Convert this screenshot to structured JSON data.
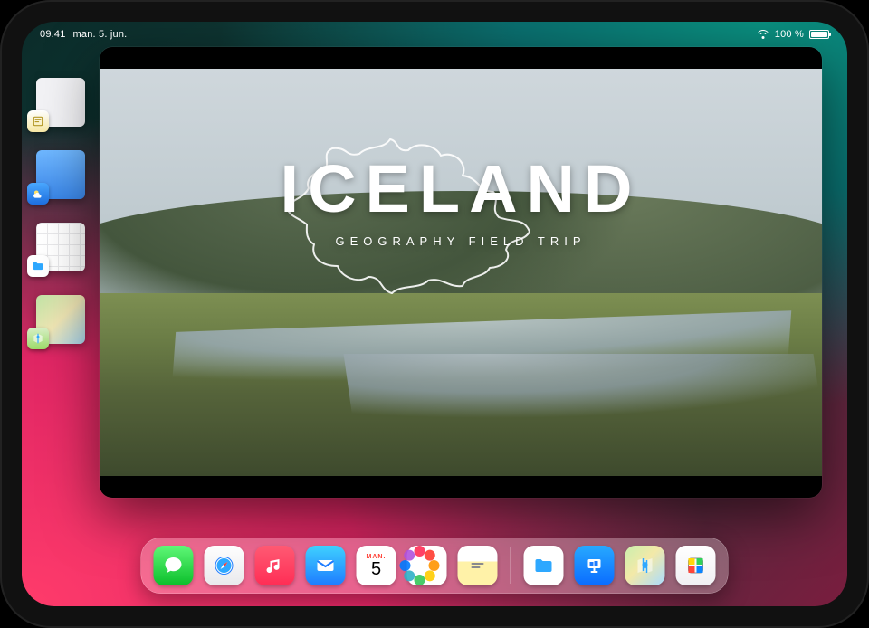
{
  "status": {
    "time": "09.41",
    "date": "man. 5. jun.",
    "battery_text": "100 %"
  },
  "stage_rail": {
    "items": [
      {
        "app": "notes",
        "name": "notes-window"
      },
      {
        "app": "weather",
        "name": "weather-window"
      },
      {
        "app": "files",
        "name": "files-window"
      },
      {
        "app": "maps",
        "name": "maps-window"
      }
    ]
  },
  "main_window": {
    "app": "keynote",
    "slide": {
      "title": "ICELAND",
      "subtitle": "GEOGRAPHY FIELD TRIP"
    }
  },
  "dock": {
    "primary": [
      {
        "app": "messages",
        "label": "Messages"
      },
      {
        "app": "safari",
        "label": "Safari"
      },
      {
        "app": "music",
        "label": "Music"
      },
      {
        "app": "mail",
        "label": "Mail"
      },
      {
        "app": "calendar",
        "label": "Calendar",
        "dow": "MAN.",
        "day": "5"
      },
      {
        "app": "photos",
        "label": "Photos"
      },
      {
        "app": "notes",
        "label": "Notes"
      }
    ],
    "recent": [
      {
        "app": "files",
        "label": "Files"
      },
      {
        "app": "keynote",
        "label": "Keynote"
      },
      {
        "app": "maps",
        "label": "Maps"
      },
      {
        "app": "freeform",
        "label": "Freeform"
      }
    ]
  },
  "colors": {
    "accent_green": "#0bbf2b",
    "accent_pink": "#ff2d55",
    "accent_blue": "#0a6cff"
  }
}
